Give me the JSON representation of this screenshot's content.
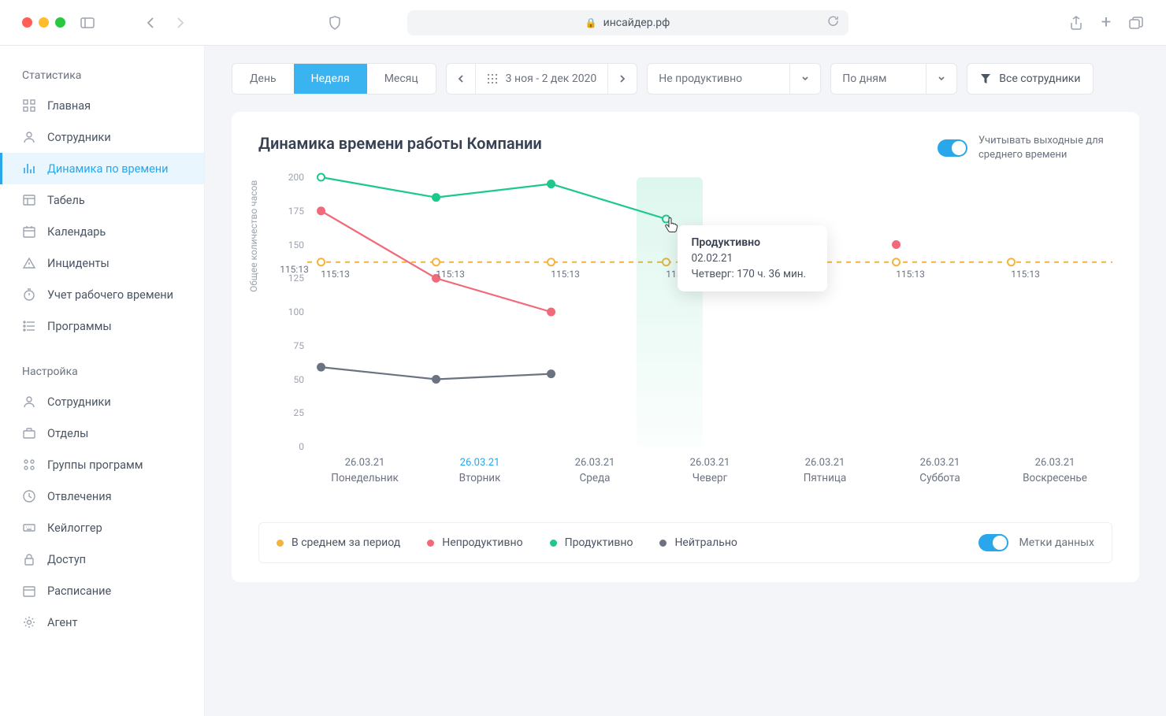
{
  "browser": {
    "url": "инсайдер.рф"
  },
  "sidebar": {
    "groups": [
      {
        "title": "Статистика",
        "items": [
          {
            "label": "Главная"
          },
          {
            "label": "Сотрудники"
          },
          {
            "label": "Динамика по времени"
          },
          {
            "label": "Табель"
          },
          {
            "label": "Календарь"
          },
          {
            "label": "Инциденты"
          },
          {
            "label": "Учет рабочего времени"
          },
          {
            "label": "Программы"
          }
        ]
      },
      {
        "title": "Настройка",
        "items": [
          {
            "label": "Сотрудники"
          },
          {
            "label": "Отделы"
          },
          {
            "label": "Группы программ"
          },
          {
            "label": "Отвлечения"
          },
          {
            "label": "Кейлоггер"
          },
          {
            "label": "Доступ"
          },
          {
            "label": "Расписание"
          },
          {
            "label": "Агент"
          }
        ]
      }
    ]
  },
  "toolbar": {
    "range": {
      "day": "День",
      "week": "Неделя",
      "month": "Месяц"
    },
    "dateRange": "3 ноя - 2 дек 2020",
    "productivity": "Не продуктивно",
    "group": "По дням",
    "filter": "Все сотрудники"
  },
  "card": {
    "title": "Динамика времени работы Компании",
    "toggleWeekend": "Учитывать выходные для среднего времени",
    "dataLabels": "Метки данных"
  },
  "legend": {
    "avg": "В среднем за период",
    "nonprod": "Непродуктивно",
    "prod": "Продуктивно",
    "neutral": "Нейтрально"
  },
  "tooltip": {
    "title": "Продуктивно",
    "date": "02.02.21",
    "line": "Четверг:  170 ч. 36 мин."
  },
  "colors": {
    "avg": "#f2b441",
    "nonprod": "#f16a79",
    "prod": "#1cc88a",
    "neutral": "#6b7280",
    "accent": "#2aa7ea"
  },
  "chart_data": {
    "type": "line",
    "title": "Динамика времени работы Компании",
    "ylabel": "Общее количество часов",
    "xlabel": "",
    "ylim": [
      0,
      200
    ],
    "y_ticks": [
      0,
      25,
      50,
      75,
      100,
      125,
      150,
      175,
      200
    ],
    "categories": [
      "26.03.21",
      "26.03.21",
      "26.03.21",
      "26.03.21",
      "26.03.21",
      "26.03.21",
      "26.03.21"
    ],
    "day_labels": [
      "Понедельник",
      "Вторник",
      "Среда",
      "Чеверг",
      "Пятница",
      "Суббота",
      "Воскресенье"
    ],
    "active_category_index": 1,
    "highlight_index": 3,
    "avg_value": 137,
    "avg_point_label": "115:13",
    "series": [
      {
        "name": "Продуктивно",
        "color": "#1cc88a",
        "values": [
          200,
          185,
          195,
          169,
          null,
          null,
          null
        ]
      },
      {
        "name": "Непродуктивно",
        "color": "#f16a79",
        "values": [
          175,
          125,
          100,
          null,
          null,
          150,
          null
        ]
      },
      {
        "name": "Нейтрально",
        "color": "#6b7280",
        "values": [
          59,
          50,
          54,
          null,
          null,
          null,
          null
        ]
      }
    ]
  }
}
